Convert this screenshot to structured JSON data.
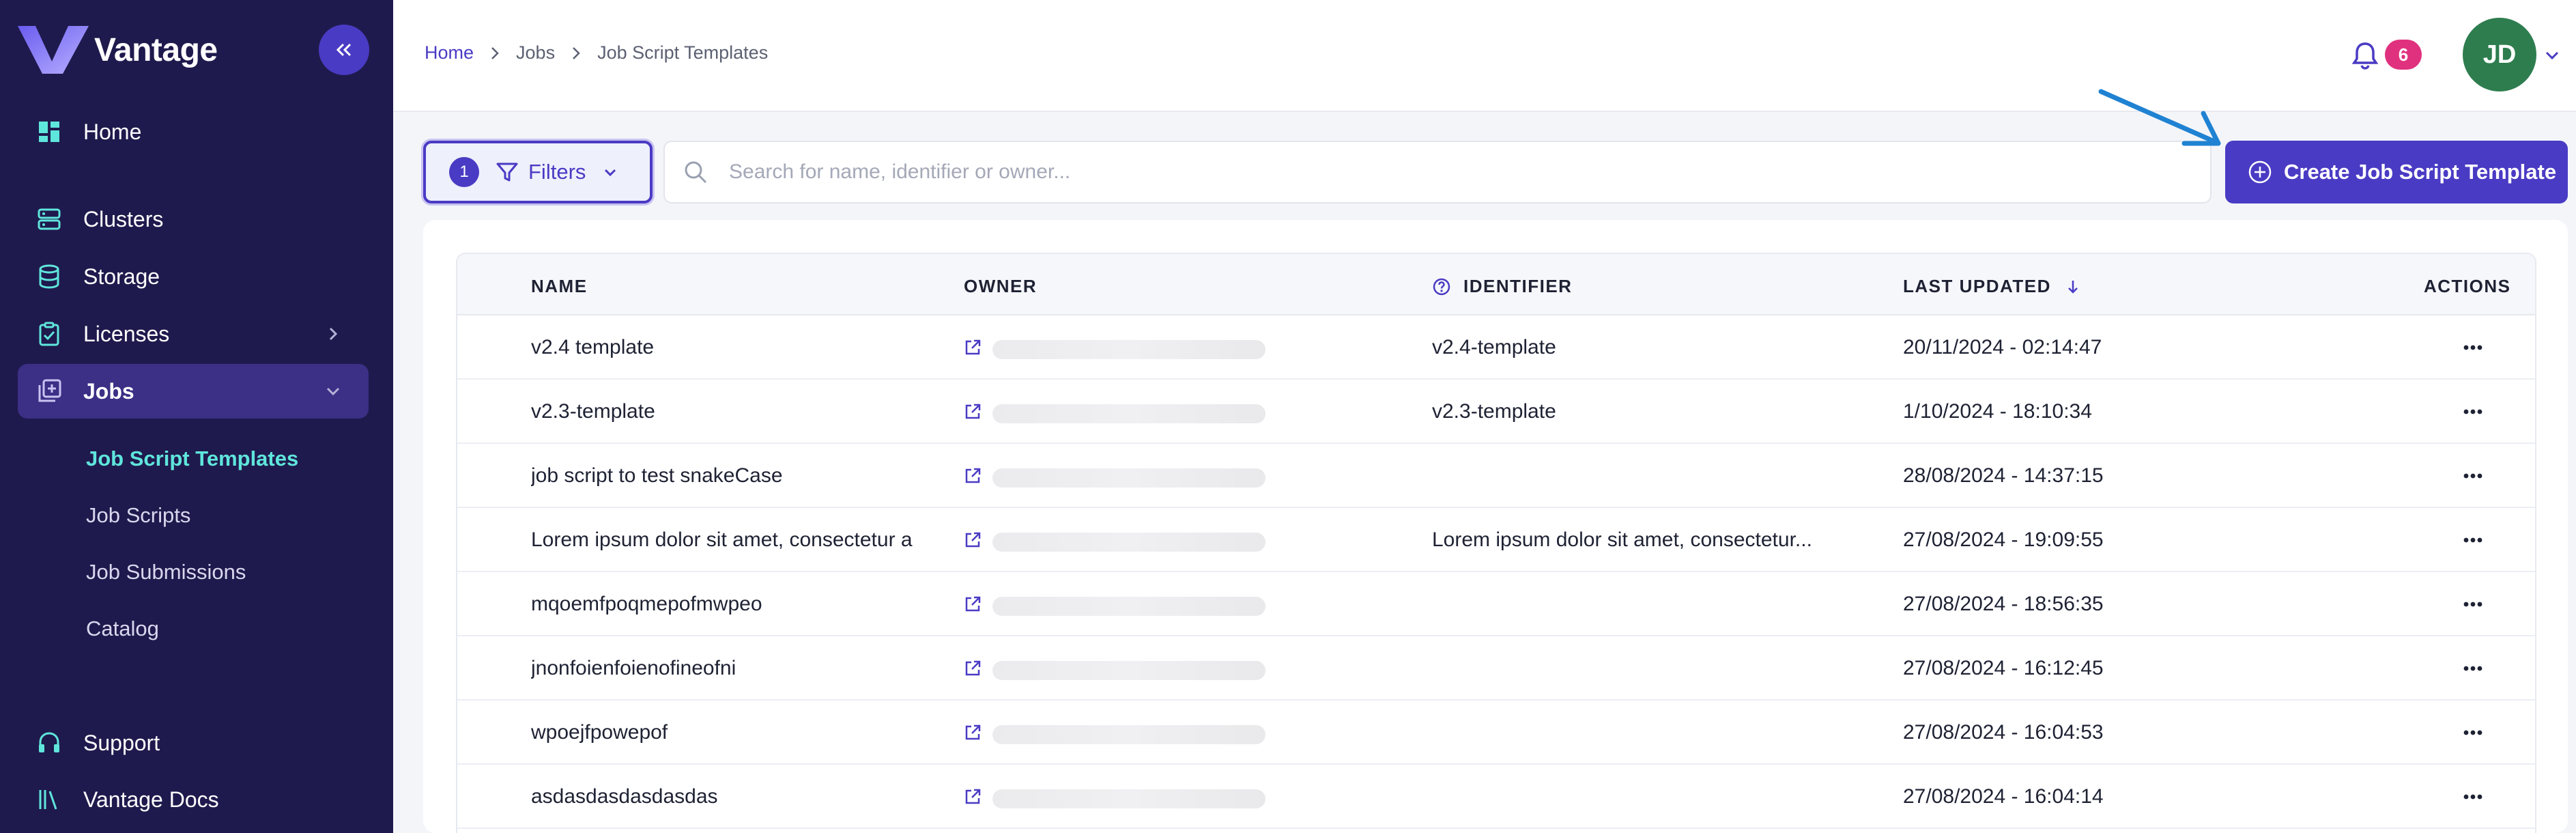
{
  "brand": {
    "name": "Vantage"
  },
  "sidebar": {
    "items": [
      {
        "label": "Home"
      },
      {
        "label": "Clusters"
      },
      {
        "label": "Storage"
      },
      {
        "label": "Licenses"
      },
      {
        "label": "Jobs"
      },
      {
        "label": "Support"
      },
      {
        "label": "Vantage Docs"
      }
    ],
    "jobs_subitems": [
      {
        "label": "Job Script Templates"
      },
      {
        "label": "Job Scripts"
      },
      {
        "label": "Job Submissions"
      },
      {
        "label": "Catalog"
      }
    ]
  },
  "header": {
    "breadcrumb": [
      "Home",
      "Jobs",
      "Job Script Templates"
    ],
    "notification_count": "6",
    "avatar_initials": "JD"
  },
  "toolbar": {
    "filter_count": "1",
    "filters_label": "Filters",
    "search_placeholder": "Search for name, identifier or owner...",
    "create_label": "Create Job Script Template"
  },
  "table": {
    "columns": {
      "name": "NAME",
      "owner": "OWNER",
      "identifier": "IDENTIFIER",
      "last_updated": "LAST UPDATED",
      "actions": "ACTIONS"
    },
    "rows": [
      {
        "name": "v2.4 template",
        "identifier": "v2.4-template",
        "last_updated": "20/11/2024 - 02:14:47"
      },
      {
        "name": "v2.3-template",
        "identifier": "v2.3-template",
        "last_updated": "1/10/2024 - 18:10:34"
      },
      {
        "name": "job script to test snakeCase",
        "identifier": "",
        "last_updated": "28/08/2024 - 14:37:15"
      },
      {
        "name": "Lorem ipsum dolor sit amet, consectetur a",
        "identifier": "Lorem ipsum dolor sit amet, consectetur...",
        "last_updated": "27/08/2024 - 19:09:55"
      },
      {
        "name": "mqoemfpoqmepofmwpeo",
        "identifier": "",
        "last_updated": "27/08/2024 - 18:56:35"
      },
      {
        "name": "jnonfoienfoienofineofni",
        "identifier": "",
        "last_updated": "27/08/2024 - 16:12:45"
      },
      {
        "name": "wpoejfpowepof",
        "identifier": "",
        "last_updated": "27/08/2024 - 16:04:53"
      },
      {
        "name": "asdasdasdasdasdas",
        "identifier": "",
        "last_updated": "27/08/2024 - 16:04:14"
      }
    ]
  },
  "colors": {
    "sidebar_bg": "#1f1a4d",
    "accent": "#4a3bc4",
    "active_sub": "#5fe6dc",
    "badge": "#e0317e",
    "avatar": "#2e7d4f"
  }
}
